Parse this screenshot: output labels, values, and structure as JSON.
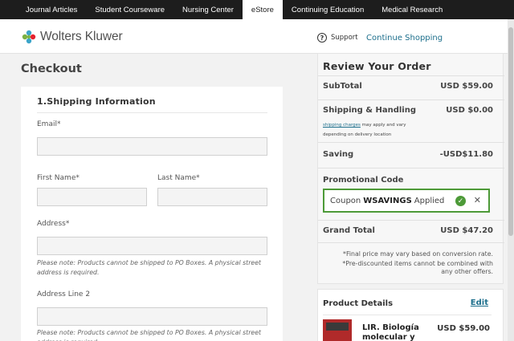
{
  "topnav": {
    "tabs": [
      {
        "label": "Journal Articles"
      },
      {
        "label": "Student Courseware"
      },
      {
        "label": "Nursing Center"
      },
      {
        "label": "eStore"
      },
      {
        "label": "Continuing Education"
      },
      {
        "label": "Medical Research"
      }
    ],
    "active_index": 3
  },
  "header": {
    "logo_text": "Wolters Kluwer",
    "support_label": "Support",
    "continue_label": "Continue Shopping",
    "link_color": "#1d6f8c"
  },
  "checkout": {
    "title": "Checkout",
    "section_title": "1.Shipping Information",
    "email_label": "Email*",
    "first_name_label": "First Name*",
    "last_name_label": "Last Name*",
    "address_label": "Address*",
    "address_note": "Please note: Products cannot be shipped to PO Boxes. A physical street address is required.",
    "address2_label": "Address Line 2",
    "address2_note": "Please note: Products cannot be shipped to PO Boxes. A physical street address is required."
  },
  "summary": {
    "title": "Review Your Order",
    "subtotal_label": "SubTotal",
    "subtotal_value": "USD $59.00",
    "shipping_label": "Shipping & Handling",
    "shipping_value": "USD $0.00",
    "shipping_link": "shipping charges",
    "shipping_note": "may apply and vary depending on delivery location",
    "saving_label": "Saving",
    "saving_value": "-USD$11.80",
    "promo_label": "Promotional Code",
    "coupon_prefix": "Coupon",
    "coupon_code": "WSAVINGS",
    "coupon_suffix": "Applied",
    "grand_total_label": "Grand Total",
    "grand_total_value": "USD $47.20",
    "note1": "*Final price may vary based on conversion rate.",
    "note2": "*Pre-discounted items cannot be combined with any other offers.",
    "coupon_color": "#4d9a38"
  },
  "product_details": {
    "title": "Product Details",
    "edit_label": "Edit",
    "product_name": "LIR. Biología molecular y celular",
    "product_price": "USD $59.00"
  }
}
